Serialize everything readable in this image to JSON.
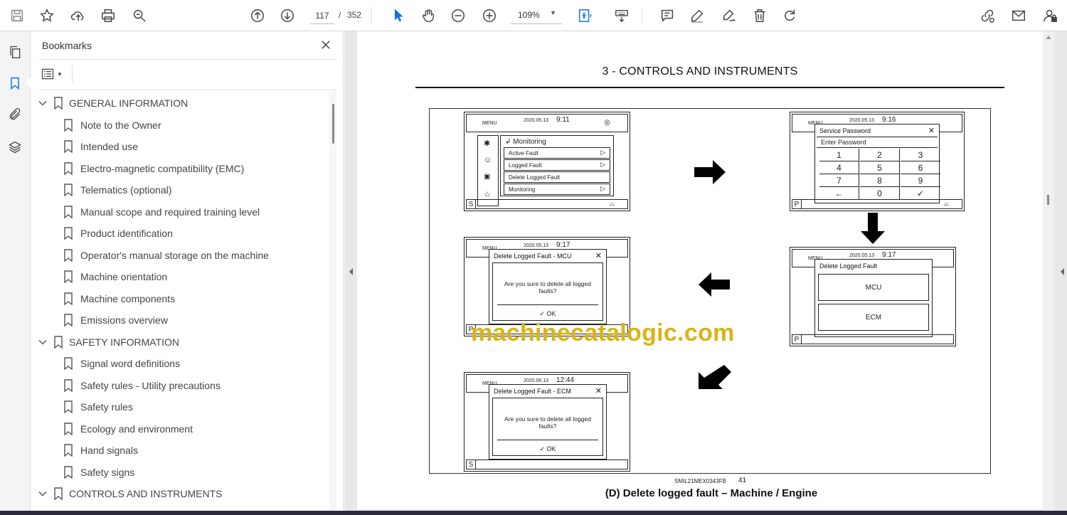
{
  "toolbar": {
    "current_page": "117",
    "page_separator": "/",
    "total_pages": "352",
    "zoom": "109%"
  },
  "bookmarks": {
    "title": "Bookmarks",
    "items": [
      {
        "label": "GENERAL INFORMATION",
        "level": 0
      },
      {
        "label": "Note to the Owner",
        "level": 1
      },
      {
        "label": "Intended use",
        "level": 1
      },
      {
        "label": "Electro-magnetic compatibility (EMC)",
        "level": 1
      },
      {
        "label": "Telematics (optional)",
        "level": 1
      },
      {
        "label": "Manual scope and required training level",
        "level": 1
      },
      {
        "label": "Product identification",
        "level": 1
      },
      {
        "label": "Operator's manual storage on the machine",
        "level": 1
      },
      {
        "label": "Machine orientation",
        "level": 1
      },
      {
        "label": "Machine components",
        "level": 1
      },
      {
        "label": "Emissions overview",
        "level": 1
      },
      {
        "label": "SAFETY INFORMATION",
        "level": 0
      },
      {
        "label": "Signal word definitions",
        "level": 1
      },
      {
        "label": "Safety rules - Utility precautions",
        "level": 1
      },
      {
        "label": "Safety rules",
        "level": 1
      },
      {
        "label": "Ecology and environment",
        "level": 1
      },
      {
        "label": "Hand signals",
        "level": 1
      },
      {
        "label": "Safety signs",
        "level": 1
      },
      {
        "label": "CONTROLS AND INSTRUMENTS",
        "level": 0
      }
    ]
  },
  "document": {
    "header": "3 - CONTROLS AND INSTRUMENTS",
    "figure_code": "SMIL21MEX0343FB",
    "figure_page": "41",
    "caption": "(D) Delete logged fault – Machine / Engine",
    "watermark": "machinecatalogic.com",
    "screens": {
      "s1": {
        "menu": "MENU",
        "date": "2020.05.13",
        "time": "9:11",
        "mode": "S",
        "title": "Monitoring",
        "rows": [
          "Active Fault",
          "Logged Fault",
          "Delete Logged Fault",
          "Monitoring"
        ]
      },
      "s2": {
        "menu": "MENU",
        "date": "2020.05.13",
        "time": "9:16",
        "mode": "P",
        "dialog_title": "Service Password",
        "prompt": "Enter Password",
        "keys": [
          "1",
          "2",
          "3",
          "4",
          "5",
          "6",
          "7",
          "8",
          "9",
          "←",
          "0",
          "✓"
        ]
      },
      "s3": {
        "menu": "MENU",
        "date": "2020.05.13",
        "time": "9:17",
        "mode": "P",
        "dialog_title": "Delete Logged Fault",
        "options": [
          "MCU",
          "ECM"
        ]
      },
      "s4": {
        "menu": "MENU",
        "date": "2020.05.13",
        "time": "9:17",
        "mode": "P",
        "dialog_title": "Delete Logged Fault - MCU",
        "question_line1": "Are you sure to delete all logged",
        "question_line2": "faults?",
        "ok": "OK"
      },
      "s5": {
        "menu": "MENU",
        "date": "2020.06.13",
        "time": "12:44",
        "mode": "S",
        "dialog_title": "Delete Logged Fault - ECM",
        "question_line1": "Are you sure to delete all logged",
        "question_line2": "faults?",
        "ok": "OK"
      }
    }
  }
}
